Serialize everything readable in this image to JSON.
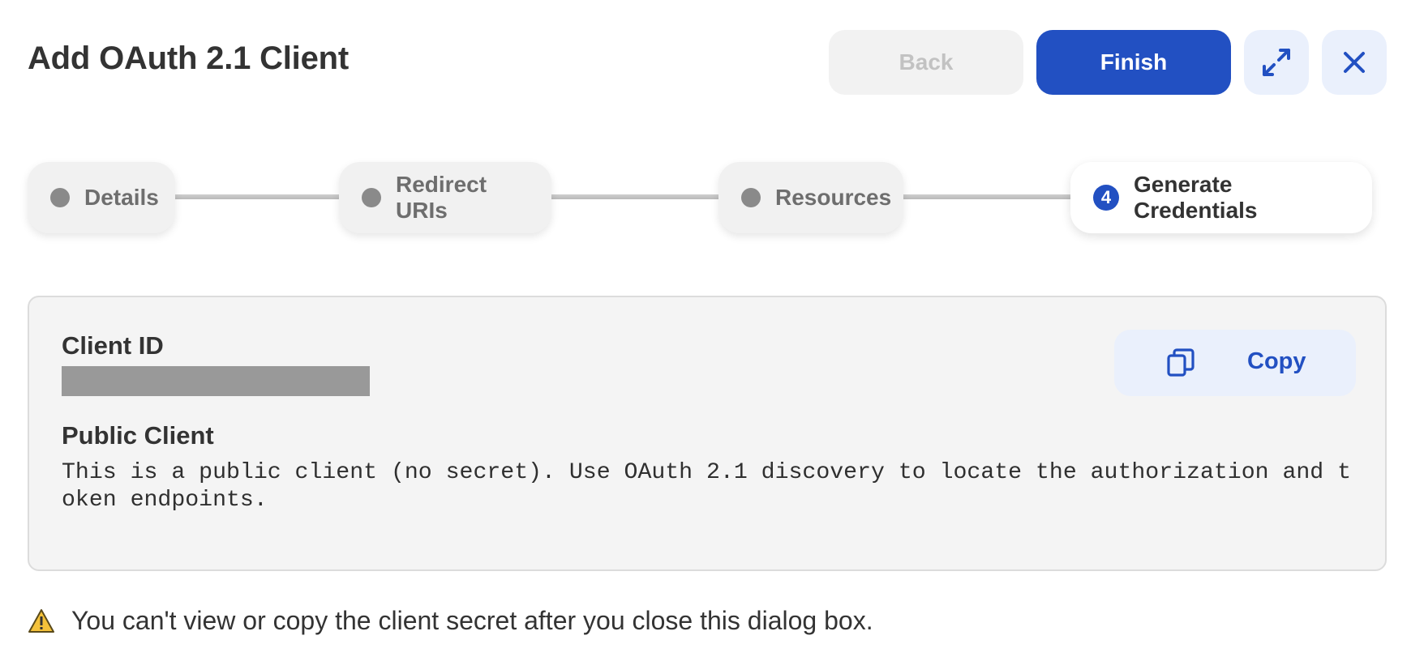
{
  "header": {
    "title": "Add OAuth 2.1 Client",
    "back_label": "Back",
    "finish_label": "Finish"
  },
  "steps": [
    {
      "label": "Details",
      "state": "inactive"
    },
    {
      "label": "Redirect URIs",
      "state": "inactive"
    },
    {
      "label": "Resources",
      "state": "inactive"
    },
    {
      "label": "Generate Credentials",
      "state": "active",
      "number": "4"
    }
  ],
  "credentials": {
    "client_id_label": "Client ID",
    "copy_label": "Copy",
    "public_label": "Public Client",
    "public_description": "This is a public client (no secret). Use OAuth 2.1 discovery to locate the authorization and t\noken endpoints."
  },
  "warning": {
    "text": "You can't view or copy the client secret after you close this dialog box."
  },
  "colors": {
    "accent": "#2250c2",
    "accent_light": "#eaf0fc",
    "warning_fill": "#f5c23a"
  },
  "icons": {
    "expand": "expand-icon",
    "close": "close-icon",
    "copy": "copy-icon",
    "warning": "warning-icon"
  }
}
